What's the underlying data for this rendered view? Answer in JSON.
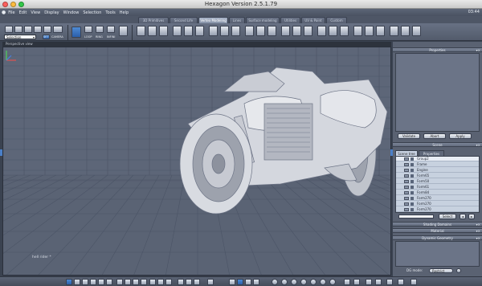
{
  "window": {
    "title": "Hexagon Version 2.5.1.79",
    "traffic_light_colors": [
      "#fc605c",
      "#fdbc40",
      "#34c84a"
    ]
  },
  "menubar": {
    "items": [
      "File",
      "Edit",
      "View",
      "Display",
      "Window",
      "Selection",
      "Tools",
      "Help"
    ],
    "clock": "03:44"
  },
  "tabs": [
    {
      "label": "3D Primitives",
      "active": false
    },
    {
      "label": "Second Life",
      "active": false
    },
    {
      "label": "Vertex Modeling",
      "active": true
    },
    {
      "label": "Lines",
      "active": false
    },
    {
      "label": "Surface modeling",
      "active": false
    },
    {
      "label": "Utilities",
      "active": false
    },
    {
      "label": "UV & Paint",
      "active": false
    },
    {
      "label": "Custom",
      "active": false
    }
  ],
  "toolbar": {
    "selection_dropdown": "Selection",
    "labels": [
      "SET",
      "CAMERA",
      "LOOP",
      "RING",
      "INFINI"
    ]
  },
  "viewport": {
    "label": "Perspective view",
    "object_label": "hell rider *",
    "background_color": "#5d6678",
    "grid_color": "#4b5466"
  },
  "sidebar": {
    "properties": {
      "title": "Properties",
      "buttons": [
        "Validate",
        "Abort",
        "Apply"
      ]
    },
    "scene": {
      "title": "Scene",
      "tabs": [
        "Scene tree",
        "Properties"
      ],
      "items": [
        "Group2",
        "Frame",
        "Engine",
        "Form65",
        "Form50",
        "Form61",
        "Form84",
        "Form270",
        "Form270",
        "Form270"
      ],
      "select_button": "Select"
    },
    "collapsed_panels": [
      "Shading Domains",
      "Material"
    ],
    "dynamic_geometry": {
      "title": "Dynamic Geometry",
      "mode_label": "DG mode:",
      "mode_value": "Restrict"
    }
  },
  "accent_color": "#3a76c4"
}
